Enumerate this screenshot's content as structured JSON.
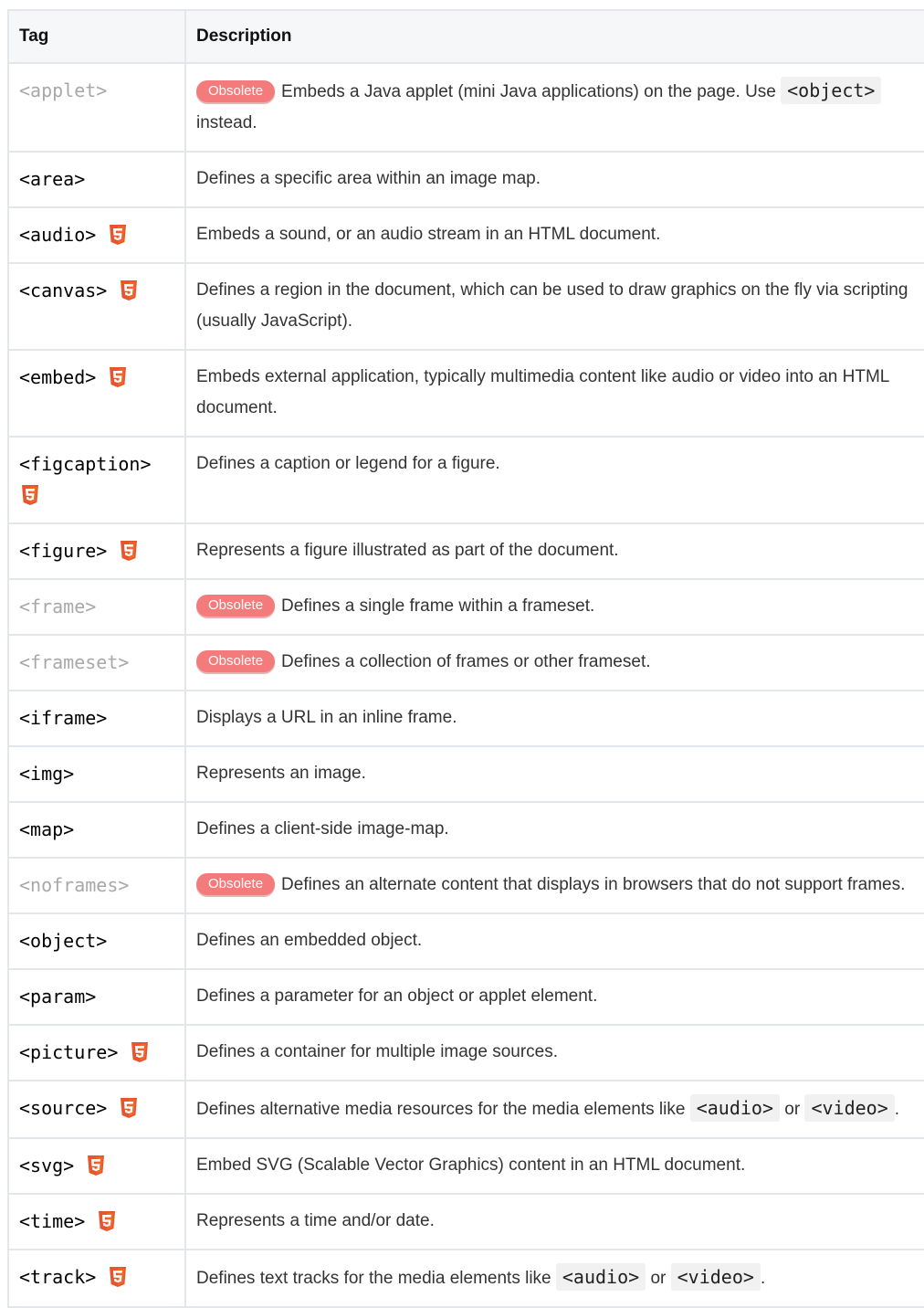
{
  "header": {
    "tag": "Tag",
    "description": "Description"
  },
  "obsolete_label": "Obsolete",
  "rows": [
    {
      "tag": "<applet>",
      "obsolete": true,
      "html5": false,
      "desc": "Embeds a Java applet (mini Java applications) on the page. Use ",
      "code1": "<object>",
      "mid": " instead.",
      "code2": null,
      "tail": ""
    },
    {
      "tag": "<area>",
      "obsolete": false,
      "html5": false,
      "desc": "Defines a specific area within an image map."
    },
    {
      "tag": "<audio>",
      "obsolete": false,
      "html5": true,
      "desc": "Embeds a sound, or an audio stream in an HTML document."
    },
    {
      "tag": "<canvas>",
      "obsolete": false,
      "html5": true,
      "desc": "Defines a region in the document, which can be used to draw graphics on the fly via scripting (usually JavaScript)."
    },
    {
      "tag": "<embed>",
      "obsolete": false,
      "html5": true,
      "desc": "Embeds external application, typically multimedia content like audio or video into an HTML document."
    },
    {
      "tag": "<figcaption>",
      "obsolete": false,
      "html5": true,
      "desc": "Defines a caption or legend for a figure."
    },
    {
      "tag": "<figure>",
      "obsolete": false,
      "html5": true,
      "desc": "Represents a figure illustrated as part of the document."
    },
    {
      "tag": "<frame>",
      "obsolete": true,
      "html5": false,
      "desc": "Defines a single frame within a frameset."
    },
    {
      "tag": "<frameset>",
      "obsolete": true,
      "html5": false,
      "desc": "Defines a collection of frames or other frameset."
    },
    {
      "tag": "<iframe>",
      "obsolete": false,
      "html5": false,
      "desc": "Displays a URL in an inline frame."
    },
    {
      "tag": "<img>",
      "obsolete": false,
      "html5": false,
      "desc": "Represents an image."
    },
    {
      "tag": "<map>",
      "obsolete": false,
      "html5": false,
      "desc": "Defines a client-side image-map."
    },
    {
      "tag": "<noframes>",
      "obsolete": true,
      "html5": false,
      "desc": "Defines an alternate content that displays in browsers that do not support frames."
    },
    {
      "tag": "<object>",
      "obsolete": false,
      "html5": false,
      "desc": "Defines an embedded object."
    },
    {
      "tag": "<param>",
      "obsolete": false,
      "html5": false,
      "desc": "Defines a parameter for an object or applet element."
    },
    {
      "tag": "<picture>",
      "obsolete": false,
      "html5": true,
      "desc": "Defines a container for multiple image sources."
    },
    {
      "tag": "<source>",
      "obsolete": false,
      "html5": true,
      "desc": "Defines alternative media resources for the media elements like ",
      "code1": "<audio>",
      "mid": " or ",
      "code2": "<video>",
      "tail": "."
    },
    {
      "tag": "<svg>",
      "obsolete": false,
      "html5": true,
      "desc": "Embed SVG (Scalable Vector Graphics) content in an HTML document."
    },
    {
      "tag": "<time>",
      "obsolete": false,
      "html5": true,
      "desc": "Represents a time and/or date."
    },
    {
      "tag": "<track>",
      "obsolete": false,
      "html5": true,
      "desc": "Defines text tracks for the media elements like ",
      "code1": "<audio>",
      "mid": " or ",
      "code2": "<video>",
      "tail": "."
    }
  ]
}
